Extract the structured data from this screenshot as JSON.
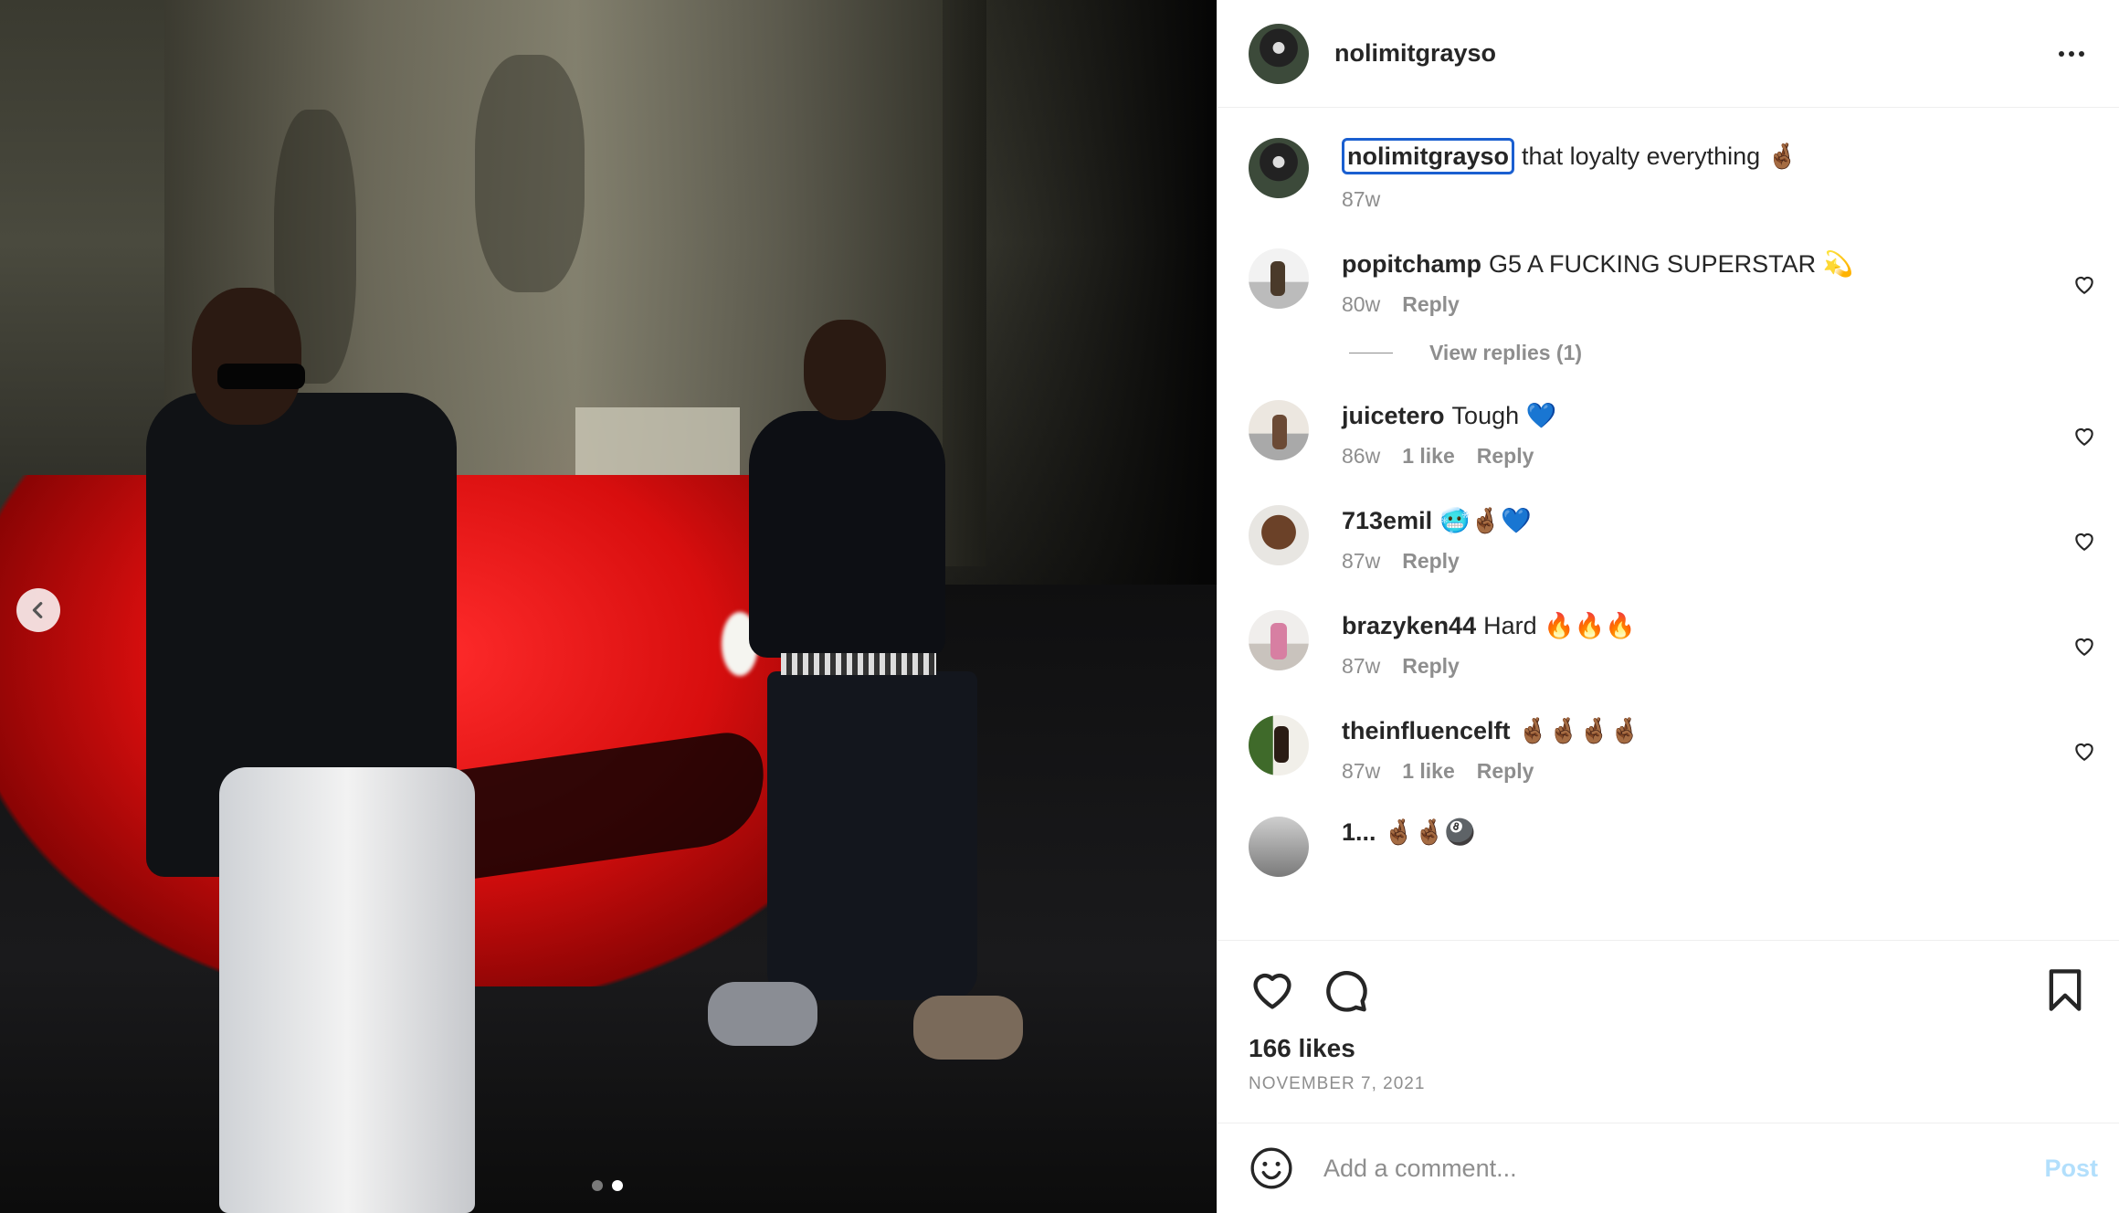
{
  "post": {
    "username": "nolimitgrayso",
    "caption_text": "that loyalty everything 🤞🏾",
    "caption_age": "87w",
    "likes": "166 likes",
    "date": "NOVEMBER 7, 2021",
    "carousel": {
      "total_slides": 2,
      "active_slide": 2
    }
  },
  "comments": [
    {
      "username": "popitchamp",
      "text": "G5 A FUCKING SUPERSTAR 💫",
      "age": "80w",
      "likes": "",
      "reply": "Reply",
      "view_replies": "View replies (1)"
    },
    {
      "username": "juicetero",
      "text": "Tough 💙",
      "age": "86w",
      "likes": "1 like",
      "reply": "Reply"
    },
    {
      "username": "713emil",
      "text": "🥶🤞🏾💙",
      "age": "87w",
      "likes": "",
      "reply": "Reply"
    },
    {
      "username": "brazyken44",
      "text": "Hard 🔥🔥🔥",
      "age": "87w",
      "likes": "",
      "reply": "Reply"
    },
    {
      "username": "theinfluencelft",
      "text": "🤞🏾🤞🏾🤞🏾🤞🏾",
      "age": "87w",
      "likes": "1 like",
      "reply": "Reply"
    },
    {
      "username": "1...",
      "text": "🤞🏾🤞🏾🎱"
    }
  ],
  "comment_box": {
    "placeholder": "Add a comment...",
    "post_label": "Post"
  },
  "icons": {
    "prev": "chevron-left-icon",
    "more": "more-options-icon",
    "like": "heart-icon",
    "comment": "comment-bubble-icon",
    "save": "bookmark-icon",
    "emoji": "emoji-smile-icon"
  },
  "colors": {
    "link_blue": "#1a5fd0",
    "post_button_disabled": "#b2dffc",
    "secondary_text": "#8e8e8e"
  }
}
